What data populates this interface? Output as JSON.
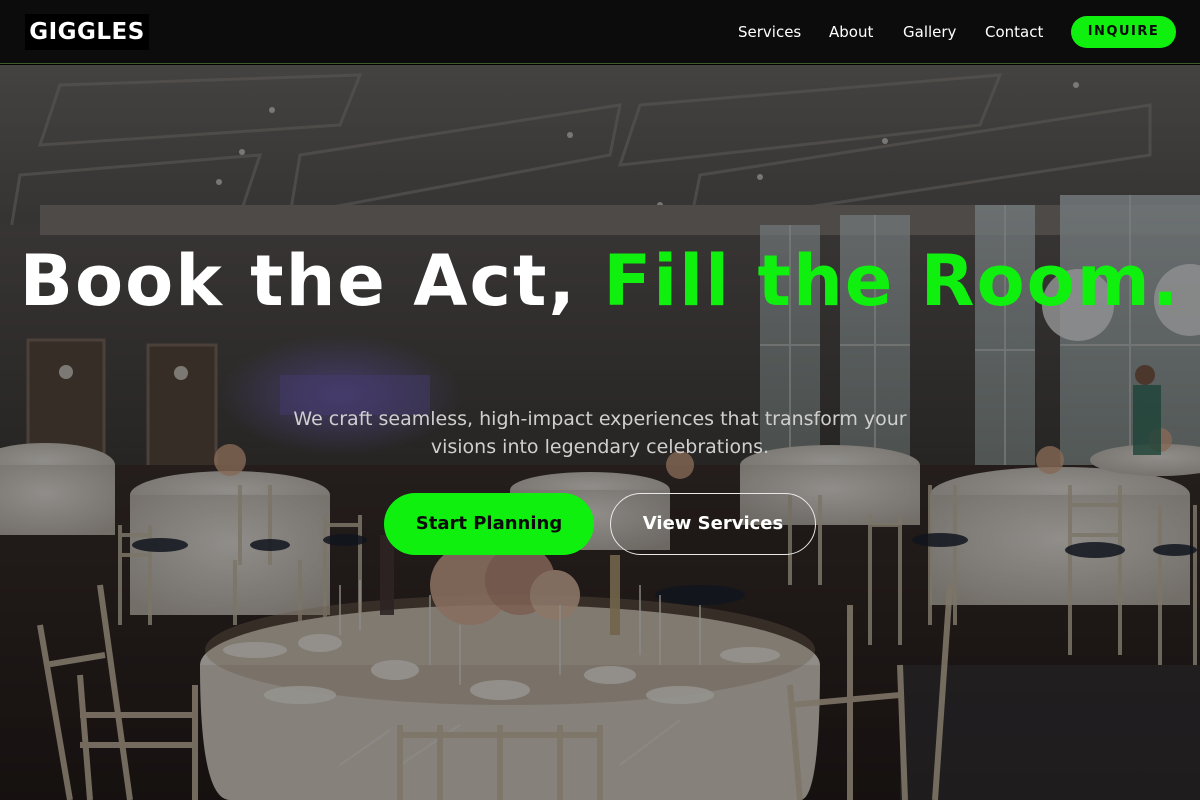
{
  "brand": {
    "logo_text": "GIGGLES"
  },
  "nav": {
    "items": [
      {
        "label": "Services"
      },
      {
        "label": "About"
      },
      {
        "label": "Gallery"
      },
      {
        "label": "Contact"
      }
    ],
    "cta_label": "INQUIRE"
  },
  "hero": {
    "headline_part1": "Book the Act, ",
    "headline_accent": "Fill the Room.",
    "subtitle": "We craft seamless, high-impact experiences that transform your visions into legendary celebrations.",
    "primary_button": "Start Planning",
    "secondary_button": "View Services",
    "background_image": "banquet-hall-photo"
  },
  "colors": {
    "accent": "#0ff00f",
    "header_bg": "#0c0c0c",
    "text": "#ffffff"
  }
}
